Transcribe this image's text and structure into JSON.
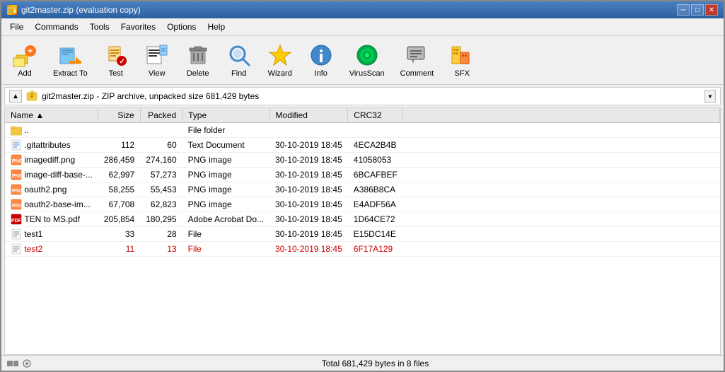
{
  "window": {
    "title": "git2master.zip (evaluation copy)",
    "icon": "zip-icon"
  },
  "menu": {
    "items": [
      "File",
      "Commands",
      "Tools",
      "Favorites",
      "Options",
      "Help"
    ]
  },
  "toolbar": {
    "buttons": [
      {
        "id": "add",
        "label": "Add",
        "icon": "add-icon"
      },
      {
        "id": "extract-to",
        "label": "Extract To",
        "icon": "extract-icon"
      },
      {
        "id": "test",
        "label": "Test",
        "icon": "test-icon"
      },
      {
        "id": "view",
        "label": "View",
        "icon": "view-icon"
      },
      {
        "id": "delete",
        "label": "Delete",
        "icon": "delete-icon"
      },
      {
        "id": "find",
        "label": "Find",
        "icon": "find-icon"
      },
      {
        "id": "wizard",
        "label": "Wizard",
        "icon": "wizard-icon"
      },
      {
        "id": "info",
        "label": "Info",
        "icon": "info-icon"
      },
      {
        "id": "virusscan",
        "label": "VirusScan",
        "icon": "virusscan-icon"
      },
      {
        "id": "comment",
        "label": "Comment",
        "icon": "comment-icon"
      },
      {
        "id": "sfx",
        "label": "SFX",
        "icon": "sfx-icon"
      }
    ]
  },
  "path_bar": {
    "path": "git2master.zip - ZIP archive, unpacked size 681,429 bytes",
    "zip_icon": "zip-small-icon"
  },
  "columns": [
    "Name",
    "Size",
    "Packed",
    "Type",
    "Modified",
    "CRC32"
  ],
  "files": [
    {
      "name": "..",
      "size": "",
      "packed": "",
      "type": "File folder",
      "modified": "",
      "crc32": "",
      "icon": "folder",
      "red": false
    },
    {
      "name": ".gitattributes",
      "size": "112",
      "packed": "60",
      "type": "Text Document",
      "modified": "30-10-2019 18:45",
      "crc32": "4ECA2B4B",
      "icon": "txt",
      "red": false
    },
    {
      "name": "imagediff.png",
      "size": "286,459",
      "packed": "274,160",
      "type": "PNG image",
      "modified": "30-10-2019 18:45",
      "crc32": "41058053",
      "icon": "png",
      "red": false
    },
    {
      "name": "image-diff-base-...",
      "size": "62,997",
      "packed": "57,273",
      "type": "PNG image",
      "modified": "30-10-2019 18:45",
      "crc32": "6BCAFBEF",
      "icon": "png",
      "red": false
    },
    {
      "name": "oauth2.png",
      "size": "58,255",
      "packed": "55,453",
      "type": "PNG image",
      "modified": "30-10-2019 18:45",
      "crc32": "A386B8CA",
      "icon": "png",
      "red": false
    },
    {
      "name": "oauth2-base-im...",
      "size": "67,708",
      "packed": "62,823",
      "type": "PNG image",
      "modified": "30-10-2019 18:45",
      "crc32": "E4ADF56A",
      "icon": "png",
      "red": false
    },
    {
      "name": "TEN to MS.pdf",
      "size": "205,854",
      "packed": "180,295",
      "type": "Adobe Acrobat Do...",
      "modified": "30-10-2019 18:45",
      "crc32": "1D64CE72",
      "icon": "pdf",
      "red": false
    },
    {
      "name": "test1",
      "size": "33",
      "packed": "28",
      "type": "File",
      "modified": "30-10-2019 18:45",
      "crc32": "E15DC14E",
      "icon": "file",
      "red": false
    },
    {
      "name": "test2",
      "size": "11",
      "packed": "13",
      "type": "File",
      "modified": "30-10-2019 18:45",
      "crc32": "6F17A129",
      "icon": "file",
      "red": true
    }
  ],
  "status": {
    "text": "Total 681,429 bytes in 8 files"
  }
}
